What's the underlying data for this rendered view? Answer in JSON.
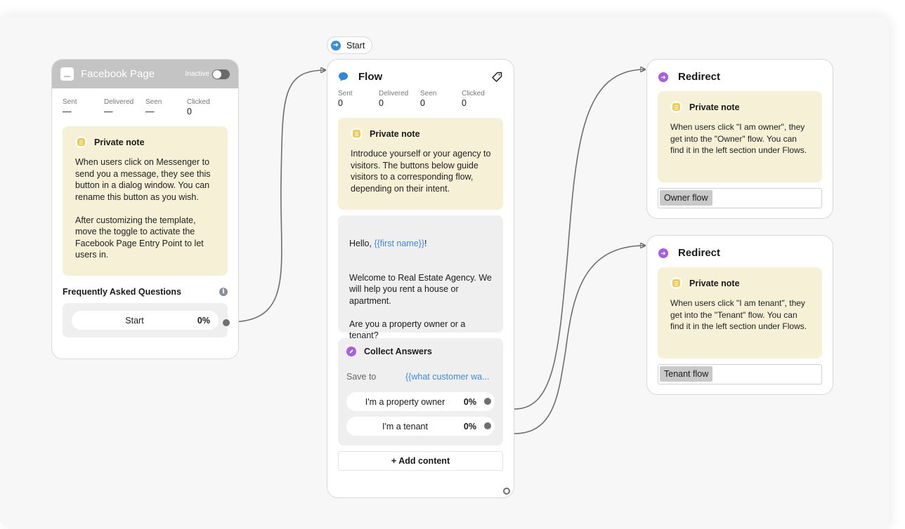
{
  "stat_labels": {
    "sent": "Sent",
    "delivered": "Delivered",
    "seen": "Seen",
    "clicked": "Clicked"
  },
  "facebook_node": {
    "title": "Facebook Page",
    "status": "Inactive",
    "toggle_on": false,
    "stats": {
      "sent": "—",
      "delivered": "—",
      "seen": "—",
      "clicked": "0"
    },
    "note": {
      "title": "Private note",
      "text": "When users click on Messenger to send you a message, they see this button in a dialog window. You can rename this button as you wish.\n\nAfter customizing the template, move the toggle to activate the Facebook Page Entry Point to let users in."
    },
    "faq_title": "Frequently Asked Questions",
    "faq_button": {
      "label": "Start",
      "percent": "0%"
    }
  },
  "start_chip": {
    "label": "Start"
  },
  "flow_node": {
    "title": "Flow",
    "stats": {
      "sent": "0",
      "delivered": "0",
      "seen": "0",
      "clicked": "0"
    },
    "note": {
      "title": "Private note",
      "text": "Introduce yourself or your agency to visitors. The buttons below guide visitors to a corresponding flow, depending on their intent."
    },
    "message": {
      "greeting": "Hello, ",
      "greeting_var": "{{first name}}",
      "greeting_end": "!",
      "body": "Welcome to Real Estate Agency. We will help you rent a house or apartment.\n\nAre you a property owner or a tenant?"
    },
    "collect": {
      "title": "Collect Answers",
      "save_label": "Save to",
      "save_value": "{{what customer wa...",
      "buttons": [
        {
          "label": "I'm a property owner",
          "percent": "0%"
        },
        {
          "label": "I'm a tenant",
          "percent": "0%"
        }
      ]
    },
    "add_content": "+ Add content"
  },
  "redirects": [
    {
      "title": "Redirect",
      "note_title": "Private note",
      "note_text": "When users click \"I am owner\", they get into the \"Owner\" flow. You can find it in the left section under Flows.",
      "flow": "Owner flow"
    },
    {
      "title": "Redirect",
      "note_title": "Private note",
      "note_text": "When users click \"I am tenant\", they get into the \"Tenant\" flow. You can find it in the left section under Flows.",
      "flow": "Tenant flow"
    }
  ],
  "colors": {
    "accent_blue": "#3b8cdf",
    "redirect_purple": "#a85ee0",
    "note_yellow": "#f5f0d6",
    "note_icon": "#f2c94c"
  }
}
